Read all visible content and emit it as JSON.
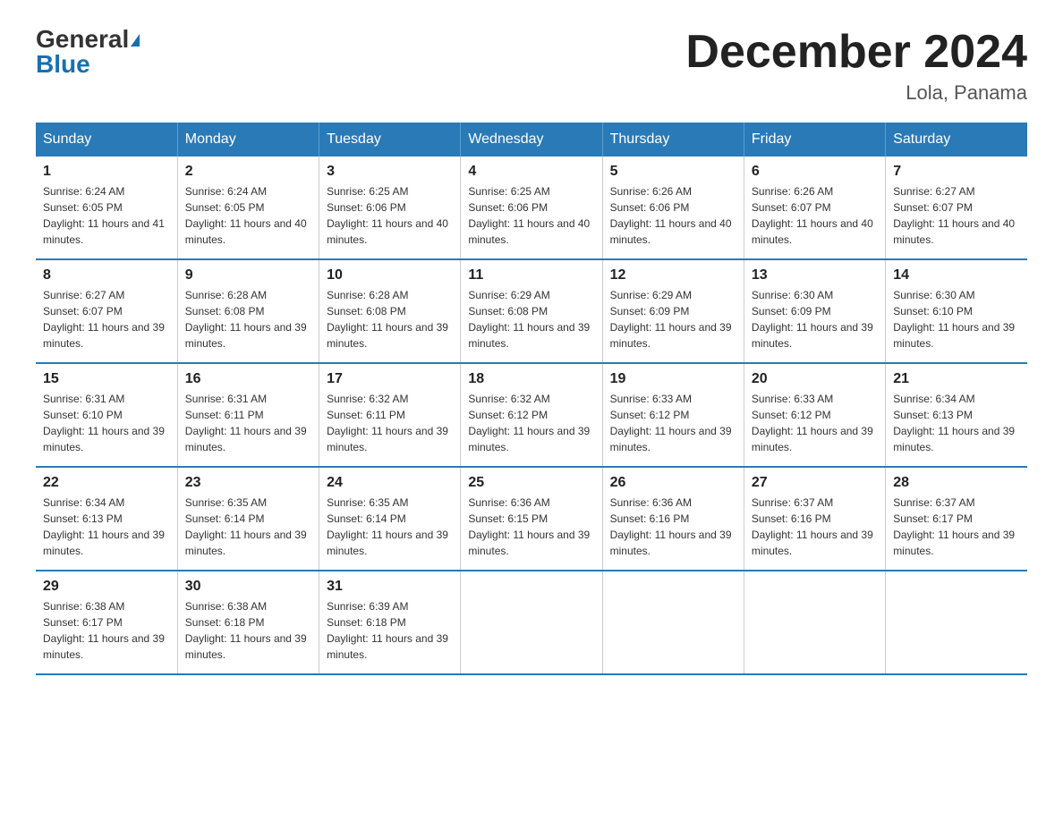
{
  "logo": {
    "general": "General",
    "blue": "Blue"
  },
  "title": "December 2024",
  "location": "Lola, Panama",
  "days_of_week": [
    "Sunday",
    "Monday",
    "Tuesday",
    "Wednesday",
    "Thursday",
    "Friday",
    "Saturday"
  ],
  "weeks": [
    [
      {
        "day": "1",
        "sunrise": "6:24 AM",
        "sunset": "6:05 PM",
        "daylight": "11 hours and 41 minutes."
      },
      {
        "day": "2",
        "sunrise": "6:24 AM",
        "sunset": "6:05 PM",
        "daylight": "11 hours and 40 minutes."
      },
      {
        "day": "3",
        "sunrise": "6:25 AM",
        "sunset": "6:06 PM",
        "daylight": "11 hours and 40 minutes."
      },
      {
        "day": "4",
        "sunrise": "6:25 AM",
        "sunset": "6:06 PM",
        "daylight": "11 hours and 40 minutes."
      },
      {
        "day": "5",
        "sunrise": "6:26 AM",
        "sunset": "6:06 PM",
        "daylight": "11 hours and 40 minutes."
      },
      {
        "day": "6",
        "sunrise": "6:26 AM",
        "sunset": "6:07 PM",
        "daylight": "11 hours and 40 minutes."
      },
      {
        "day": "7",
        "sunrise": "6:27 AM",
        "sunset": "6:07 PM",
        "daylight": "11 hours and 40 minutes."
      }
    ],
    [
      {
        "day": "8",
        "sunrise": "6:27 AM",
        "sunset": "6:07 PM",
        "daylight": "11 hours and 39 minutes."
      },
      {
        "day": "9",
        "sunrise": "6:28 AM",
        "sunset": "6:08 PM",
        "daylight": "11 hours and 39 minutes."
      },
      {
        "day": "10",
        "sunrise": "6:28 AM",
        "sunset": "6:08 PM",
        "daylight": "11 hours and 39 minutes."
      },
      {
        "day": "11",
        "sunrise": "6:29 AM",
        "sunset": "6:08 PM",
        "daylight": "11 hours and 39 minutes."
      },
      {
        "day": "12",
        "sunrise": "6:29 AM",
        "sunset": "6:09 PM",
        "daylight": "11 hours and 39 minutes."
      },
      {
        "day": "13",
        "sunrise": "6:30 AM",
        "sunset": "6:09 PM",
        "daylight": "11 hours and 39 minutes."
      },
      {
        "day": "14",
        "sunrise": "6:30 AM",
        "sunset": "6:10 PM",
        "daylight": "11 hours and 39 minutes."
      }
    ],
    [
      {
        "day": "15",
        "sunrise": "6:31 AM",
        "sunset": "6:10 PM",
        "daylight": "11 hours and 39 minutes."
      },
      {
        "day": "16",
        "sunrise": "6:31 AM",
        "sunset": "6:11 PM",
        "daylight": "11 hours and 39 minutes."
      },
      {
        "day": "17",
        "sunrise": "6:32 AM",
        "sunset": "6:11 PM",
        "daylight": "11 hours and 39 minutes."
      },
      {
        "day": "18",
        "sunrise": "6:32 AM",
        "sunset": "6:12 PM",
        "daylight": "11 hours and 39 minutes."
      },
      {
        "day": "19",
        "sunrise": "6:33 AM",
        "sunset": "6:12 PM",
        "daylight": "11 hours and 39 minutes."
      },
      {
        "day": "20",
        "sunrise": "6:33 AM",
        "sunset": "6:12 PM",
        "daylight": "11 hours and 39 minutes."
      },
      {
        "day": "21",
        "sunrise": "6:34 AM",
        "sunset": "6:13 PM",
        "daylight": "11 hours and 39 minutes."
      }
    ],
    [
      {
        "day": "22",
        "sunrise": "6:34 AM",
        "sunset": "6:13 PM",
        "daylight": "11 hours and 39 minutes."
      },
      {
        "day": "23",
        "sunrise": "6:35 AM",
        "sunset": "6:14 PM",
        "daylight": "11 hours and 39 minutes."
      },
      {
        "day": "24",
        "sunrise": "6:35 AM",
        "sunset": "6:14 PM",
        "daylight": "11 hours and 39 minutes."
      },
      {
        "day": "25",
        "sunrise": "6:36 AM",
        "sunset": "6:15 PM",
        "daylight": "11 hours and 39 minutes."
      },
      {
        "day": "26",
        "sunrise": "6:36 AM",
        "sunset": "6:16 PM",
        "daylight": "11 hours and 39 minutes."
      },
      {
        "day": "27",
        "sunrise": "6:37 AM",
        "sunset": "6:16 PM",
        "daylight": "11 hours and 39 minutes."
      },
      {
        "day": "28",
        "sunrise": "6:37 AM",
        "sunset": "6:17 PM",
        "daylight": "11 hours and 39 minutes."
      }
    ],
    [
      {
        "day": "29",
        "sunrise": "6:38 AM",
        "sunset": "6:17 PM",
        "daylight": "11 hours and 39 minutes."
      },
      {
        "day": "30",
        "sunrise": "6:38 AM",
        "sunset": "6:18 PM",
        "daylight": "11 hours and 39 minutes."
      },
      {
        "day": "31",
        "sunrise": "6:39 AM",
        "sunset": "6:18 PM",
        "daylight": "11 hours and 39 minutes."
      },
      null,
      null,
      null,
      null
    ]
  ]
}
